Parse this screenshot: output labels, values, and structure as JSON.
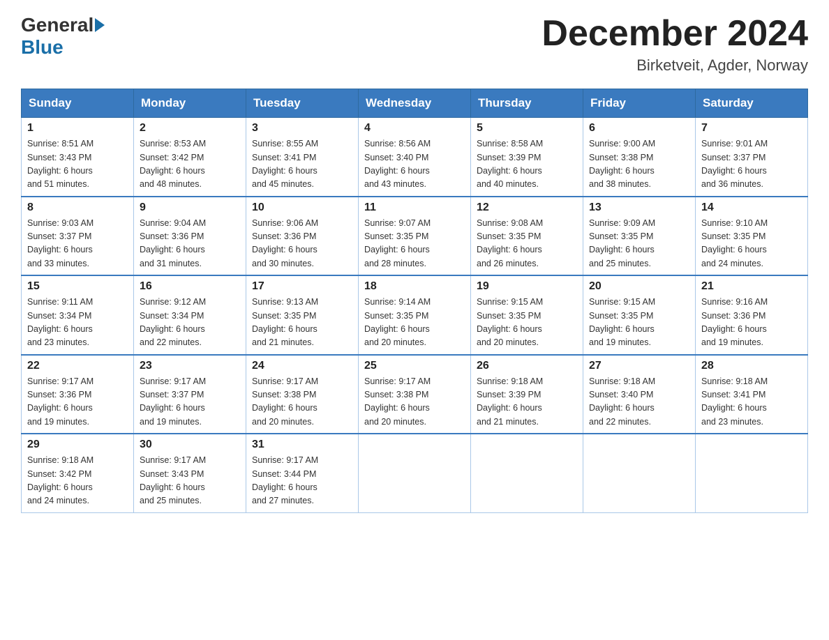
{
  "header": {
    "logo_general": "General",
    "logo_blue": "Blue",
    "month_title": "December 2024",
    "location": "Birketveit, Agder, Norway"
  },
  "days_of_week": [
    "Sunday",
    "Monday",
    "Tuesday",
    "Wednesday",
    "Thursday",
    "Friday",
    "Saturday"
  ],
  "weeks": [
    [
      {
        "day": "1",
        "sunrise": "8:51 AM",
        "sunset": "3:43 PM",
        "daylight": "6 hours and 51 minutes."
      },
      {
        "day": "2",
        "sunrise": "8:53 AM",
        "sunset": "3:42 PM",
        "daylight": "6 hours and 48 minutes."
      },
      {
        "day": "3",
        "sunrise": "8:55 AM",
        "sunset": "3:41 PM",
        "daylight": "6 hours and 45 minutes."
      },
      {
        "day": "4",
        "sunrise": "8:56 AM",
        "sunset": "3:40 PM",
        "daylight": "6 hours and 43 minutes."
      },
      {
        "day": "5",
        "sunrise": "8:58 AM",
        "sunset": "3:39 PM",
        "daylight": "6 hours and 40 minutes."
      },
      {
        "day": "6",
        "sunrise": "9:00 AM",
        "sunset": "3:38 PM",
        "daylight": "6 hours and 38 minutes."
      },
      {
        "day": "7",
        "sunrise": "9:01 AM",
        "sunset": "3:37 PM",
        "daylight": "6 hours and 36 minutes."
      }
    ],
    [
      {
        "day": "8",
        "sunrise": "9:03 AM",
        "sunset": "3:37 PM",
        "daylight": "6 hours and 33 minutes."
      },
      {
        "day": "9",
        "sunrise": "9:04 AM",
        "sunset": "3:36 PM",
        "daylight": "6 hours and 31 minutes."
      },
      {
        "day": "10",
        "sunrise": "9:06 AM",
        "sunset": "3:36 PM",
        "daylight": "6 hours and 30 minutes."
      },
      {
        "day": "11",
        "sunrise": "9:07 AM",
        "sunset": "3:35 PM",
        "daylight": "6 hours and 28 minutes."
      },
      {
        "day": "12",
        "sunrise": "9:08 AM",
        "sunset": "3:35 PM",
        "daylight": "6 hours and 26 minutes."
      },
      {
        "day": "13",
        "sunrise": "9:09 AM",
        "sunset": "3:35 PM",
        "daylight": "6 hours and 25 minutes."
      },
      {
        "day": "14",
        "sunrise": "9:10 AM",
        "sunset": "3:35 PM",
        "daylight": "6 hours and 24 minutes."
      }
    ],
    [
      {
        "day": "15",
        "sunrise": "9:11 AM",
        "sunset": "3:34 PM",
        "daylight": "6 hours and 23 minutes."
      },
      {
        "day": "16",
        "sunrise": "9:12 AM",
        "sunset": "3:34 PM",
        "daylight": "6 hours and 22 minutes."
      },
      {
        "day": "17",
        "sunrise": "9:13 AM",
        "sunset": "3:35 PM",
        "daylight": "6 hours and 21 minutes."
      },
      {
        "day": "18",
        "sunrise": "9:14 AM",
        "sunset": "3:35 PM",
        "daylight": "6 hours and 20 minutes."
      },
      {
        "day": "19",
        "sunrise": "9:15 AM",
        "sunset": "3:35 PM",
        "daylight": "6 hours and 20 minutes."
      },
      {
        "day": "20",
        "sunrise": "9:15 AM",
        "sunset": "3:35 PM",
        "daylight": "6 hours and 19 minutes."
      },
      {
        "day": "21",
        "sunrise": "9:16 AM",
        "sunset": "3:36 PM",
        "daylight": "6 hours and 19 minutes."
      }
    ],
    [
      {
        "day": "22",
        "sunrise": "9:17 AM",
        "sunset": "3:36 PM",
        "daylight": "6 hours and 19 minutes."
      },
      {
        "day": "23",
        "sunrise": "9:17 AM",
        "sunset": "3:37 PM",
        "daylight": "6 hours and 19 minutes."
      },
      {
        "day": "24",
        "sunrise": "9:17 AM",
        "sunset": "3:38 PM",
        "daylight": "6 hours and 20 minutes."
      },
      {
        "day": "25",
        "sunrise": "9:17 AM",
        "sunset": "3:38 PM",
        "daylight": "6 hours and 20 minutes."
      },
      {
        "day": "26",
        "sunrise": "9:18 AM",
        "sunset": "3:39 PM",
        "daylight": "6 hours and 21 minutes."
      },
      {
        "day": "27",
        "sunrise": "9:18 AM",
        "sunset": "3:40 PM",
        "daylight": "6 hours and 22 minutes."
      },
      {
        "day": "28",
        "sunrise": "9:18 AM",
        "sunset": "3:41 PM",
        "daylight": "6 hours and 23 minutes."
      }
    ],
    [
      {
        "day": "29",
        "sunrise": "9:18 AM",
        "sunset": "3:42 PM",
        "daylight": "6 hours and 24 minutes."
      },
      {
        "day": "30",
        "sunrise": "9:17 AM",
        "sunset": "3:43 PM",
        "daylight": "6 hours and 25 minutes."
      },
      {
        "day": "31",
        "sunrise": "9:17 AM",
        "sunset": "3:44 PM",
        "daylight": "6 hours and 27 minutes."
      },
      null,
      null,
      null,
      null
    ]
  ],
  "labels": {
    "sunrise": "Sunrise:",
    "sunset": "Sunset:",
    "daylight": "Daylight:"
  }
}
